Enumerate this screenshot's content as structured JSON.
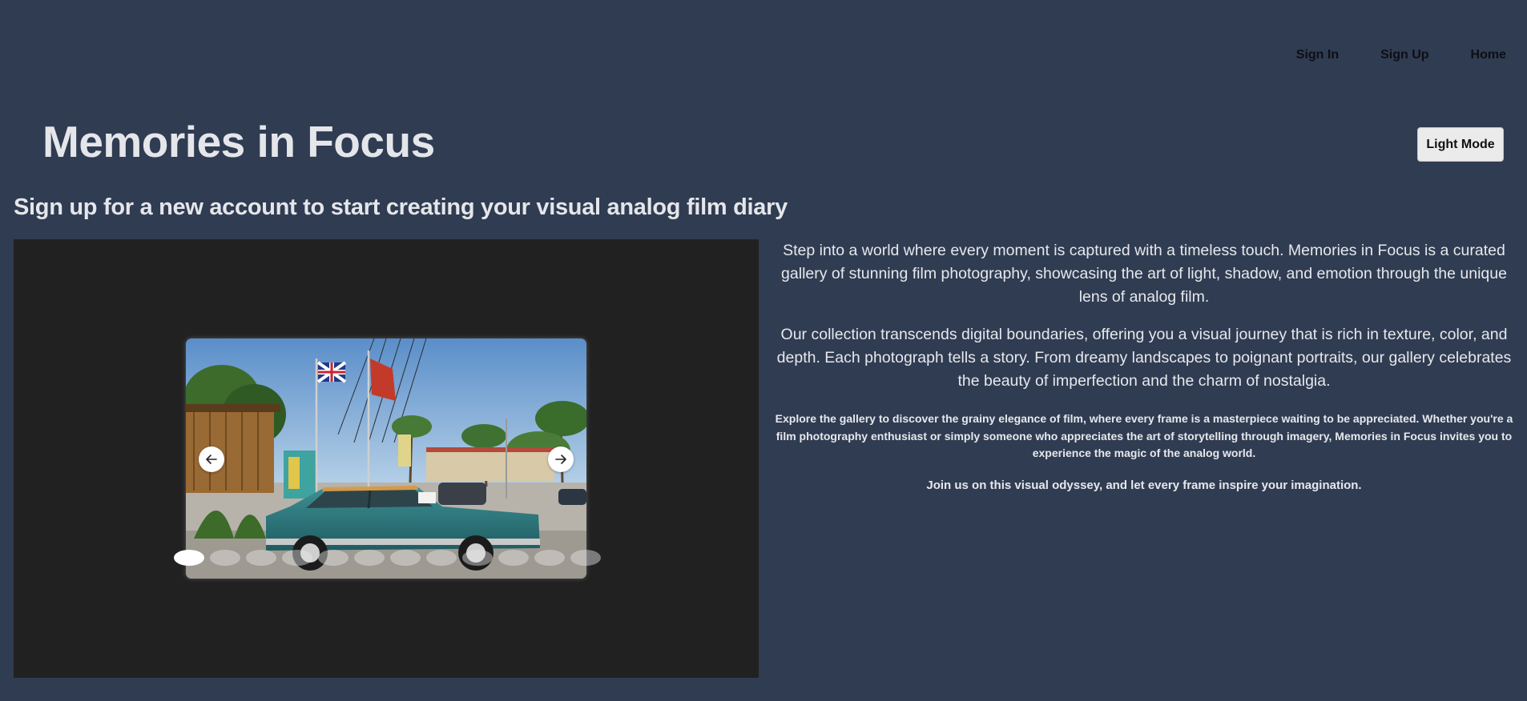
{
  "nav": {
    "items": [
      {
        "label": "Sign In"
      },
      {
        "label": "Sign Up"
      },
      {
        "label": "Home"
      }
    ]
  },
  "header": {
    "title": "Memories in Focus",
    "mode_button": "Light Mode"
  },
  "subtitle": "Sign up for a new account to start creating your visual analog film diary",
  "gallery": {
    "prev_icon": "arrow-left-icon",
    "next_icon": "arrow-right-icon",
    "slide_count": 12,
    "active_slide": 1
  },
  "description": {
    "p1": "Step into a world where every moment is captured with a timeless touch. Memories in Focus is a curated gallery of stunning film photography, showcasing the art of light, shadow, and emotion through the unique lens of analog film.",
    "p2": "Our collection transcends digital boundaries, offering you a visual journey that is rich in texture, color, and depth. Each photograph tells a story. From dreamy landscapes to poignant portraits, our gallery celebrates the beauty of imperfection and the charm of nostalgia.",
    "p3": "Explore the gallery to discover the grainy elegance of film, where every frame is a masterpiece waiting to be appreciated. Whether you're a film photography enthusiast or simply someone who appreciates the art of storytelling through imagery, Memories in Focus invites you to experience the magic of the analog world.",
    "p4_bold": "Join us",
    "p4_rest": " on this visual odyssey, and let every frame inspire your imagination."
  },
  "colors": {
    "background": "#303c52",
    "gallery_bg": "#212121",
    "text": "#e6e8ec"
  }
}
